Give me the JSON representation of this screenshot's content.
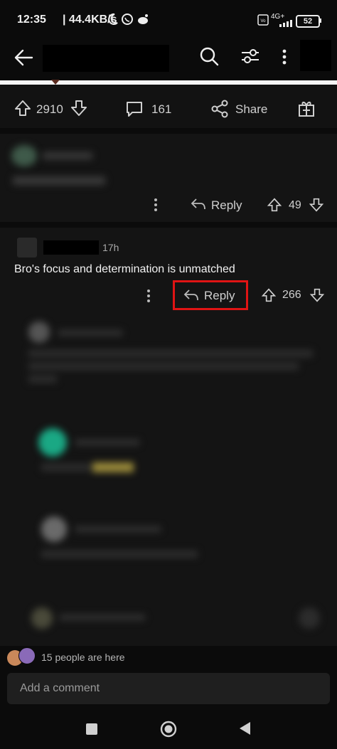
{
  "status_bar": {
    "time": "12:35",
    "network_speed": "| 44.4KB/s",
    "battery": "52",
    "signal_label": "4G+"
  },
  "post_actions": {
    "upvotes": "2910",
    "comments": "161",
    "share_label": "Share"
  },
  "comment_blurred_top": {
    "reply_label": "Reply",
    "votes": "49"
  },
  "comment_main": {
    "age": "17h",
    "text": "Bro's focus and determination is unmatched",
    "reply_label": "Reply",
    "votes": "266"
  },
  "presence": {
    "text": "15 people are here"
  },
  "composer": {
    "placeholder": "Add a comment"
  },
  "colors": {
    "highlight": "#e01414",
    "background": "#0b0b0b",
    "card": "#141414"
  }
}
